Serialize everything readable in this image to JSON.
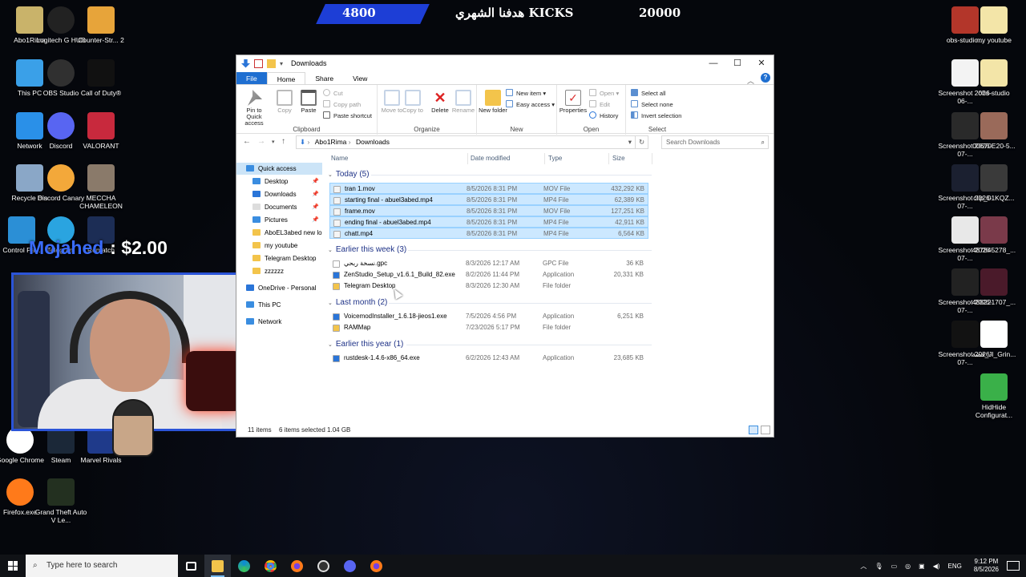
{
  "overlay": {
    "goal_current": "4800",
    "goal_label": "هدفنا الشهري KICKS",
    "goal_target": "20000",
    "donation_name": "Mojahed",
    "donation_amount": ": $2.00"
  },
  "desktop": {
    "left_icons": [
      {
        "label": "Abo1Rima",
        "icon": "user-folder-icon"
      },
      {
        "label": "Logitech G HUB",
        "icon": "logitech-g-icon"
      },
      {
        "label": "Counter-Str... 2",
        "icon": "counter-strike-icon"
      },
      {
        "label": "This PC",
        "icon": "this-pc-icon"
      },
      {
        "label": "OBS Studio",
        "icon": "obs-icon"
      },
      {
        "label": "Call of Duty®",
        "icon": "call-of-duty-icon"
      },
      {
        "label": "Network",
        "icon": "network-icon"
      },
      {
        "label": "Discord",
        "icon": "discord-icon"
      },
      {
        "label": "VALORANT",
        "icon": "valorant-icon"
      },
      {
        "label": "Recycle Bin",
        "icon": "recycle-bin-icon"
      },
      {
        "label": "Discord Canary",
        "icon": "discord-canary-icon"
      },
      {
        "label": "MECCHA CHAMELEON",
        "icon": "meccha-icon"
      },
      {
        "label": "Control Pa...",
        "icon": "control-panel-icon"
      },
      {
        "label": "Telegram",
        "icon": "telegram-icon"
      },
      {
        "label": "Rematch",
        "icon": "rematch-icon"
      },
      {
        "label": "Google Chrome",
        "icon": "chrome-icon"
      },
      {
        "label": "Steam",
        "icon": "steam-icon"
      },
      {
        "label": "Marvel Rivals",
        "icon": "marvel-rivals-icon"
      },
      {
        "label": "Firefox.exe",
        "icon": "firefox-icon"
      },
      {
        "label": "Grand Theft Auto V Le...",
        "icon": "gta-icon"
      }
    ],
    "right_icons": [
      {
        "label": "obs-studio...",
        "icon": "archive-icon"
      },
      {
        "label": "my youtube",
        "icon": "folder-icon"
      },
      {
        "label": "Screenshot 2026-06-...",
        "icon": "screenshot-icon"
      },
      {
        "label": "obs-studio",
        "icon": "folder-icon"
      },
      {
        "label": "Screenshot 2026-07-...",
        "icon": "screenshot-icon"
      },
      {
        "label": "00670E20-5...",
        "icon": "image-icon"
      },
      {
        "label": "Screenshot 2026-07-...",
        "icon": "screenshot-icon"
      },
      {
        "label": "clip_01KQZ...",
        "icon": "image-icon"
      },
      {
        "label": "Screenshot 2026-07-...",
        "icon": "screenshot-icon"
      },
      {
        "label": "487845278_...",
        "icon": "image-icon"
      },
      {
        "label": "Screenshot 2026-07-...",
        "icon": "screenshot-icon"
      },
      {
        "label": "488221707_...",
        "icon": "image-icon"
      },
      {
        "label": "Screenshot 2026-07-...",
        "icon": "screenshot-icon"
      },
      {
        "label": "قصة_Jl_Grin...",
        "icon": "video-icon"
      },
      {
        "label": "HidHide Configurat...",
        "icon": "hidhide-icon"
      }
    ]
  },
  "explorer": {
    "title": "Downloads",
    "tabs": [
      "File",
      "Home",
      "Share",
      "View"
    ],
    "ribbon": {
      "clipboard": {
        "pin": "Pin to Quick access",
        "copy": "Copy",
        "paste": "Paste",
        "cut": "Cut",
        "copy_path": "Copy path",
        "paste_shortcut": "Paste shortcut",
        "label": "Clipboard"
      },
      "organize": {
        "move_to": "Move to",
        "copy_to": "Copy to",
        "delete": "Delete",
        "rename": "Rename",
        "label": "Organize"
      },
      "new": {
        "new_folder": "New folder",
        "new_item": "New item",
        "easy_access": "Easy access",
        "label": "New"
      },
      "open": {
        "properties": "Properties",
        "open": "Open",
        "edit": "Edit",
        "history": "History",
        "label": "Open"
      },
      "select": {
        "select_all": "Select all",
        "select_none": "Select none",
        "invert": "Invert selection",
        "label": "Select"
      }
    },
    "address": [
      "Abo1Rima",
      "Downloads"
    ],
    "search_placeholder": "Search Downloads",
    "nav": [
      {
        "label": "Quick access",
        "pinned": false
      },
      {
        "label": "Desktop",
        "pinned": true
      },
      {
        "label": "Downloads",
        "pinned": true
      },
      {
        "label": "Documents",
        "pinned": true
      },
      {
        "label": "Pictures",
        "pinned": true
      },
      {
        "label": "AboEL3abed new lo",
        "pinned": false
      },
      {
        "label": "my youtube",
        "pinned": false
      },
      {
        "label": "Telegram Desktop",
        "pinned": false
      },
      {
        "label": "zzzzzz",
        "pinned": false
      },
      {
        "label": "OneDrive - Personal",
        "pinned": false
      },
      {
        "label": "This PC",
        "pinned": false
      },
      {
        "label": "Network",
        "pinned": false
      }
    ],
    "columns": [
      "Name",
      "Date modified",
      "Type",
      "Size"
    ],
    "groups": [
      {
        "label": "Today (5)",
        "files": [
          {
            "name": "tran 1.mov",
            "date": "8/5/2026 8:31 PM",
            "type": "MOV File",
            "size": "432,292 KB",
            "selected": true
          },
          {
            "name": "starting final - abuel3abed.mp4",
            "date": "8/5/2026 8:31 PM",
            "type": "MP4 File",
            "size": "62,389 KB",
            "selected": true
          },
          {
            "name": "frame.mov",
            "date": "8/5/2026 8:31 PM",
            "type": "MOV File",
            "size": "127,251 KB",
            "selected": true
          },
          {
            "name": "ending final - abuel3abed.mp4",
            "date": "8/5/2026 8:31 PM",
            "type": "MP4 File",
            "size": "42,911 KB",
            "selected": true
          },
          {
            "name": "chatt.mp4",
            "date": "8/5/2026 8:31 PM",
            "type": "MP4 File",
            "size": "6,564 KB",
            "selected": true
          }
        ]
      },
      {
        "label": "Earlier this week (3)",
        "files": [
          {
            "name": "نسخة ربحي.gpc",
            "date": "8/3/2026 12:17 AM",
            "type": "GPC File",
            "size": "36 KB",
            "selected": false
          },
          {
            "name": "ZenStudio_Setup_v1.6.1_Build_82.exe",
            "date": "8/2/2026 11:44 PM",
            "type": "Application",
            "size": "20,331 KB",
            "selected": false
          },
          {
            "name": "Telegram Desktop",
            "date": "8/3/2026 12:30 AM",
            "type": "File folder",
            "size": "",
            "selected": false
          }
        ]
      },
      {
        "label": "Last month (2)",
        "files": [
          {
            "name": "VoicemodInstaller_1.6.18-jieos1.exe",
            "date": "7/5/2026 4:56 PM",
            "type": "Application",
            "size": "6,251 KB",
            "selected": false
          },
          {
            "name": "RAMMap",
            "date": "7/23/2026 5:17 PM",
            "type": "File folder",
            "size": "",
            "selected": false
          }
        ]
      },
      {
        "label": "Earlier this year (1)",
        "files": [
          {
            "name": "rustdesk-1.4.6-x86_64.exe",
            "date": "6/2/2026 12:43 AM",
            "type": "Application",
            "size": "23,685 KB",
            "selected": false
          }
        ]
      }
    ],
    "status": {
      "items": "11 items",
      "selection": "6 items selected  1.04 GB"
    }
  },
  "taskbar": {
    "search_placeholder": "Type here to search",
    "language": "ENG",
    "time": "9:12 PM",
    "date": "8/5/2026"
  },
  "colors": {
    "accent": "#1f6fd1",
    "selection": "#cce8ff",
    "banner": "#1d3ed6"
  }
}
